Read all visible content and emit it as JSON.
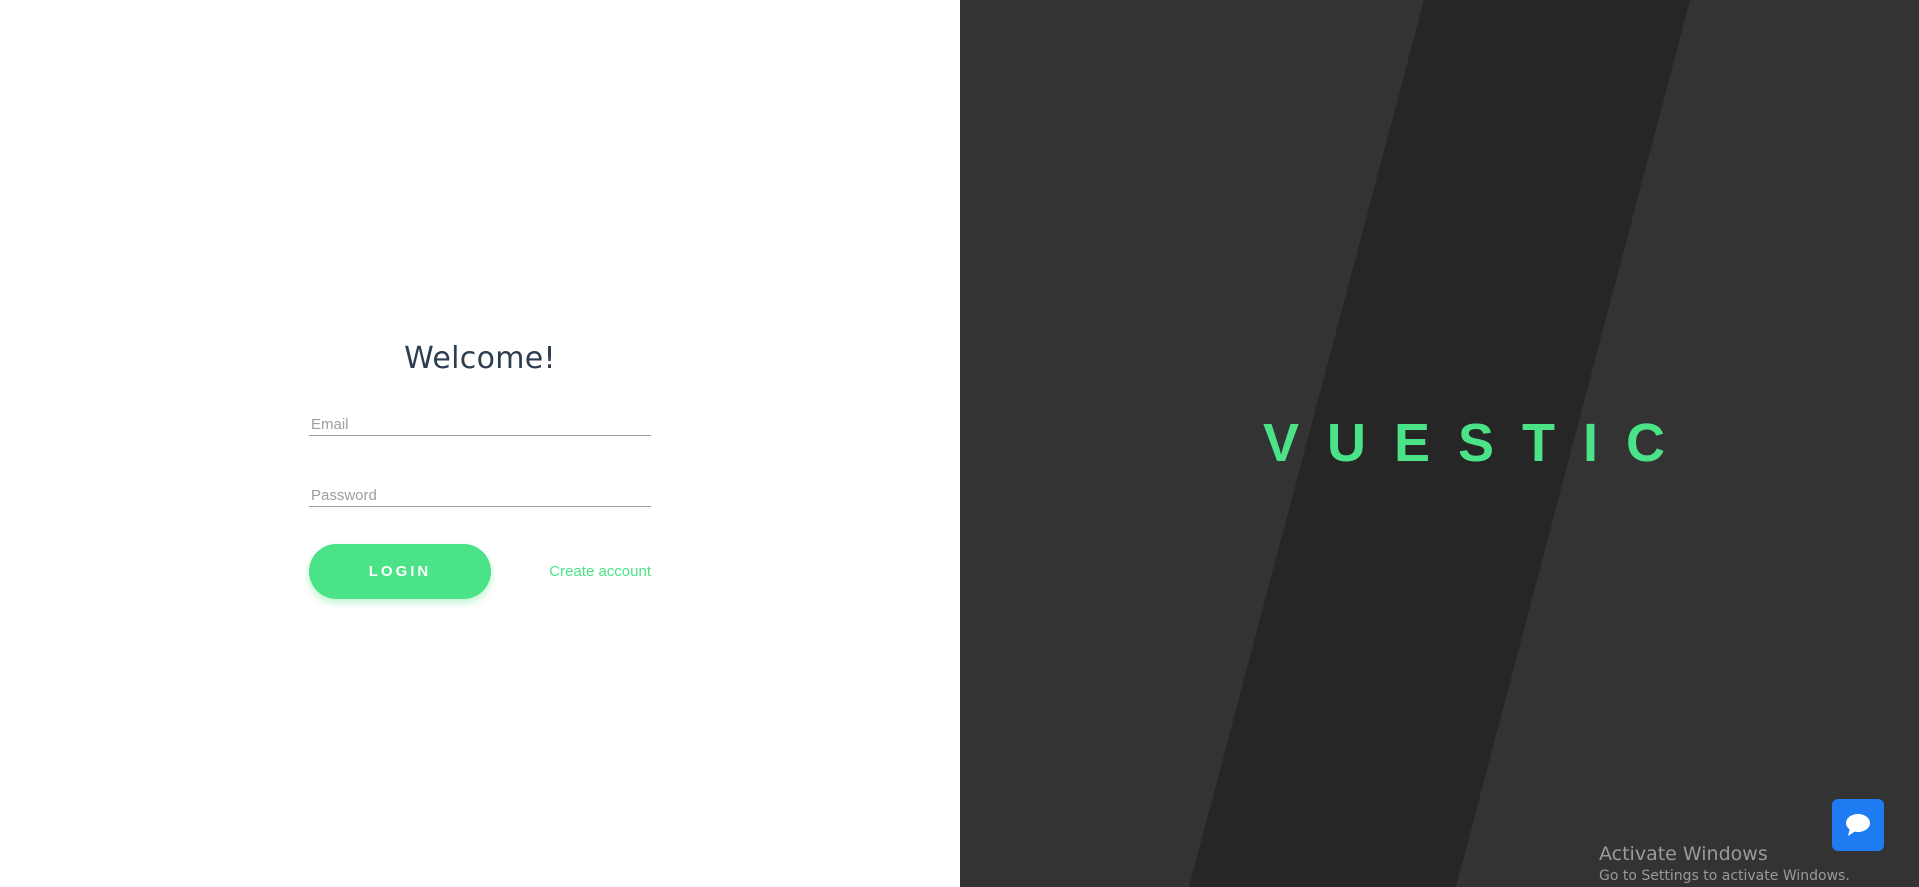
{
  "login": {
    "title": "Welcome!",
    "email_placeholder": "Email",
    "password_placeholder": "Password",
    "login_label": "LOGIN",
    "create_account_label": "Create account"
  },
  "brand": {
    "logo_text": "VUESTIC"
  },
  "colors": {
    "accent": "#4ae387",
    "right_panel_bg": "#333333",
    "stripe_bg": "#262626",
    "chat_button": "#1e7bf2"
  },
  "watermark": {
    "title": "Activate Windows",
    "subtitle": "Go to Settings to activate Windows."
  },
  "chat": {
    "icon": "chat-bubble-icon"
  }
}
